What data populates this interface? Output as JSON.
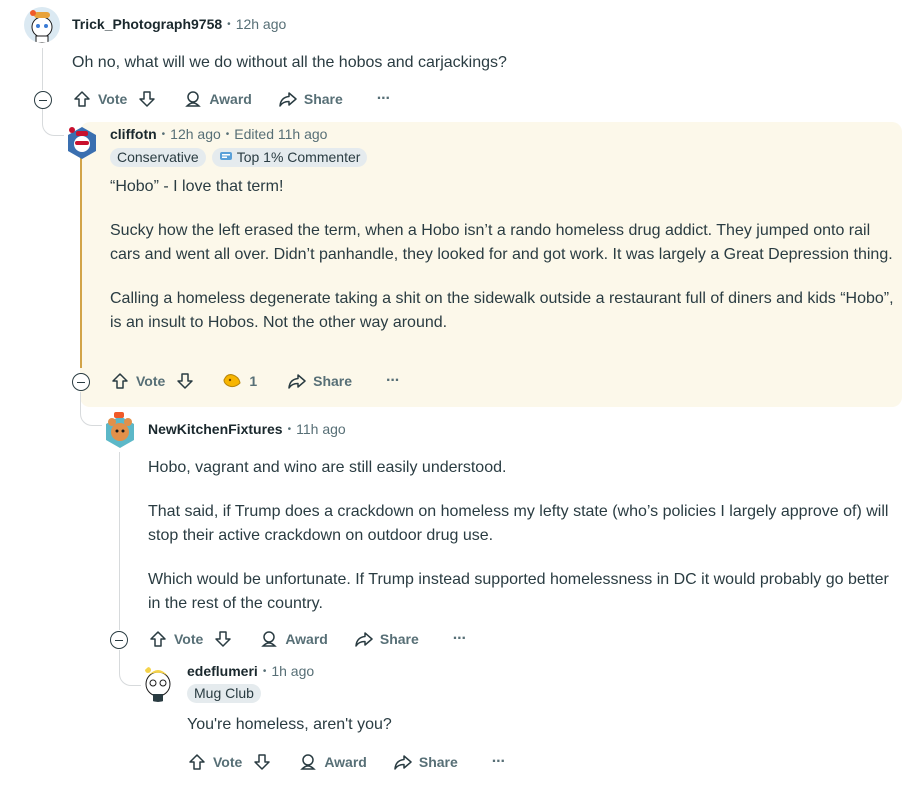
{
  "comments": [
    {
      "username": "Trick_Photograph9758",
      "time": "12h ago",
      "body": [
        "Oh no, what will we do without all the hobos and carjackings?"
      ],
      "actions": {
        "vote": "Vote",
        "award": "Award",
        "share": "Share",
        "more": "···"
      }
    },
    {
      "username": "cliffotn",
      "time": "12h ago",
      "edited": "Edited 11h ago",
      "flairs": [
        "Conservative",
        "Top 1% Commenter"
      ],
      "body": [
        "“Hobo” - I love that term!",
        "Sucky how the left erased the term, when a Hobo isn’t a rando homeless drug addict. They jumped onto rail cars and went all over. Didn’t panhandle, they looked for and got work. It was largely a Great Depression thing.",
        "Calling a homeless degenerate taking a shit on the sidewalk outside a restaurant full of diners and kids “Hobo”, is an insult to Hobos. Not the other way around."
      ],
      "actions": {
        "vote": "Vote",
        "award_count": "1",
        "share": "Share",
        "more": "···"
      }
    },
    {
      "username": "NewKitchenFixtures",
      "time": "11h ago",
      "body": [
        "Hobo, vagrant and wino are still easily understood.",
        "That said, if Trump does a crackdown on homeless my lefty state (who’s policies I largely approve of) will stop their active crackdown on outdoor drug use.",
        "Which would be unfortunate.  If Trump instead supported homelessness in DC it would probably go better in the rest of the country."
      ],
      "actions": {
        "vote": "Vote",
        "award": "Award",
        "share": "Share",
        "more": "···"
      }
    },
    {
      "username": "edeflumeri",
      "time": "1h ago",
      "flairs": [
        "Mug Club"
      ],
      "body": [
        "You're homeless, aren't you?"
      ],
      "actions": {
        "vote": "Vote",
        "award": "Award",
        "share": "Share",
        "more": "···"
      }
    }
  ],
  "sep": "•"
}
